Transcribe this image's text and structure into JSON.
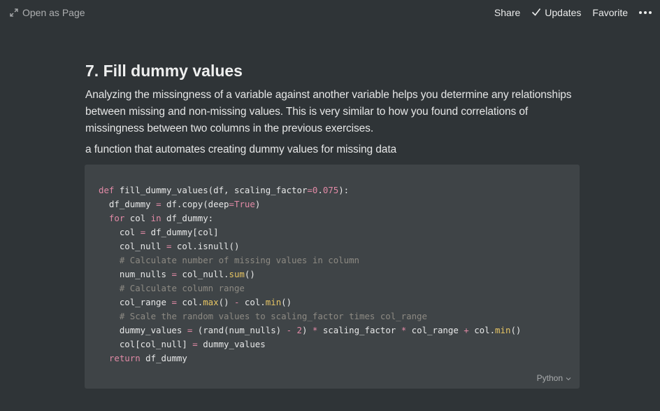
{
  "topbar": {
    "open_as_page": "Open as Page",
    "share": "Share",
    "updates": "Updates",
    "favorite": "Favorite"
  },
  "page": {
    "title": "7. Fill dummy values",
    "paragraph": "Analyzing the missingness of a variable against another variable helps you determine any relationships between missing and non-missing values. This is very similar to how you found correlations of missingness between two columns in the previous exercises.",
    "subtext": "a function that automates creating dummy values for missing data"
  },
  "code": {
    "language": "Python",
    "lines": [
      "def fill_dummy_values(df, scaling_factor=0.075):",
      "  df_dummy = df.copy(deep=True)",
      "  for col in df_dummy:",
      "    col = df_dummy[col]",
      "    col_null = col.isnull()",
      "    # Calculate number of missing values in column",
      "    num_nulls = col_null.sum()",
      "    # Calculate column range",
      "    col_range = col.max() - col.min()",
      "    # Scale the random values to scaling_factor times col_range",
      "    dummy_values = (rand(num_nulls) - 2) * scaling_factor * col_range + col.min()",
      "    col[col_null] = dummy_values",
      "  return df_dummy"
    ]
  },
  "colors": {
    "background": "#2f3437",
    "code_background": "#3f4447",
    "keyword": "#e18aa6",
    "function": "#e6c463",
    "comment": "#8d8a83"
  },
  "icons": {
    "open_page": "expand-arrows-icon",
    "updates": "checkmark-icon",
    "more": "more-dots-icon",
    "language": "chevron-down-icon"
  }
}
